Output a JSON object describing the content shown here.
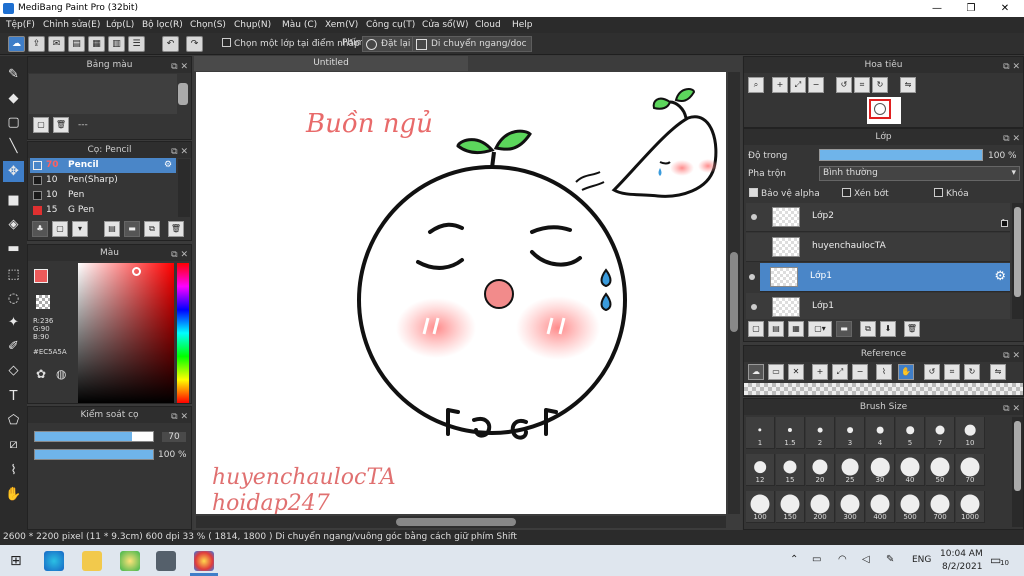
{
  "window": {
    "title": "MediBang Paint Pro (32bit)",
    "minimize": "—",
    "restore": "❐",
    "close": "✕"
  },
  "menu": [
    "Tệp(F)",
    "Chỉnh sửa(E)",
    "Lớp(L)",
    "Bộ lọc(R)",
    "Chọn(S)",
    "Chụp(N)",
    "Màu (C)",
    "Xem(V)",
    "Công cụ(T)",
    "Cửa sổ(W)",
    "Cloud",
    "Help"
  ],
  "toolbar": {
    "select_layer_label": "Chọn một lớp tại điểm nhấp",
    "key_label": "Phím",
    "reset_label": "Đặt lại",
    "move_label": "Di chuyển ngang/doc"
  },
  "panels": {
    "palette": {
      "title": "Bảng màu",
      "item": "---"
    },
    "brush": {
      "title": "Cọ: Pencil",
      "items": [
        {
          "size": "70",
          "name": "Pencil",
          "color": "#e03030"
        },
        {
          "size": "10",
          "name": "Pen(Sharp)",
          "color": "#1a1a1a"
        },
        {
          "size": "10",
          "name": "Pen",
          "color": "#1a1a1a"
        },
        {
          "size": "15",
          "name": "G Pen",
          "color": "#e03030"
        }
      ]
    },
    "color": {
      "title": "Màu",
      "r": "R:236",
      "g": "G:90",
      "b": "B:90",
      "hex": "#EC5A5A",
      "foreground": "#ec5a5a"
    },
    "brush_control": {
      "title": "Kiểm soát cọ",
      "size_value": "70",
      "opacity_value": "100 %",
      "size_fraction": 0.82,
      "opacity_fraction": 1.0
    }
  },
  "canvas": {
    "tab": "Untitled",
    "watermark_line1": "huyenchaulocTA",
    "watermark_line2": "hoidap247",
    "sleepy_text": "Buồn ngủ"
  },
  "right": {
    "navigator": {
      "title": "Hoa tiêu"
    },
    "layers": {
      "title": "Lớp",
      "opacity_label": "Độ trong",
      "opacity_value": "100 %",
      "blend_label": "Pha trộn",
      "blend_value": "Bình thường",
      "protect_alpha": "Bảo vệ alpha",
      "clipping": "Xén bớt",
      "lock": "Khóa",
      "items": [
        {
          "name": "Lớp2",
          "selected": false,
          "badge": "1"
        },
        {
          "name": "huyenchaulocTA",
          "selected": false,
          "badge": ""
        },
        {
          "name": "Lớp1",
          "selected": true,
          "badge": ""
        },
        {
          "name": "Lớp1",
          "selected": false,
          "badge": ""
        }
      ]
    },
    "reference": {
      "title": "Reference"
    },
    "brush_size": {
      "title": "Brush Size",
      "sizes": [
        "1",
        "1.5",
        "2",
        "3",
        "4",
        "5",
        "7",
        "10",
        "12",
        "15",
        "20",
        "25",
        "30",
        "40",
        "50",
        "70",
        "100",
        "150",
        "200",
        "300",
        "400",
        "500",
        "700",
        "1000"
      ]
    }
  },
  "status": {
    "text": "2600 * 2200 pixel  (11 * 9.3cm)  600 dpi  33 %  ( 1814, 1800 )  Di chuyển ngang/vuông góc bằng cách giữ phím Shift"
  },
  "taskbar": {
    "lang": "ENG",
    "time": "10:04 AM",
    "date": "8/2/2021",
    "notif": "10"
  }
}
